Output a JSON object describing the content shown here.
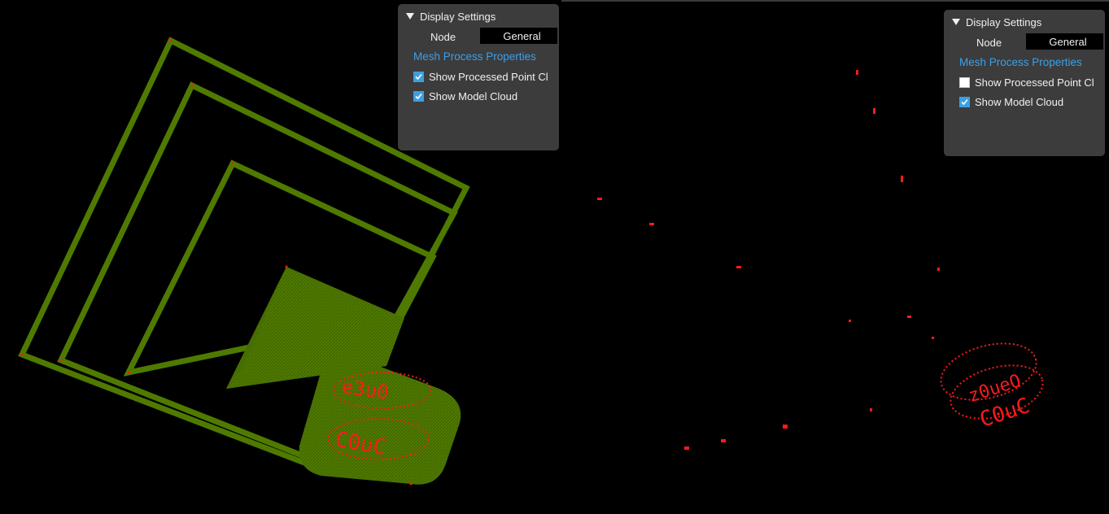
{
  "left_view": {
    "panel": {
      "title": "Display Settings",
      "node_label": "Node",
      "node_value": "General",
      "section_link": "Mesh Process Properties",
      "options": [
        {
          "label": "Show Processed Point Cl",
          "checked": true
        },
        {
          "label": "Show Model Cloud",
          "checked": true
        }
      ]
    }
  },
  "right_view": {
    "panel": {
      "title": "Display Settings",
      "node_label": "Node",
      "node_value": "General",
      "section_link": "Mesh Process Properties",
      "options": [
        {
          "label": "Show Processed Point Cl",
          "checked": false
        },
        {
          "label": "Show Model Cloud",
          "checked": true
        }
      ]
    }
  },
  "colors": {
    "model_cloud": "#4f7a00",
    "processed_points": "#ff1a1a",
    "panel_bg": "#3c3c3c",
    "accent": "#3d9fe0"
  }
}
